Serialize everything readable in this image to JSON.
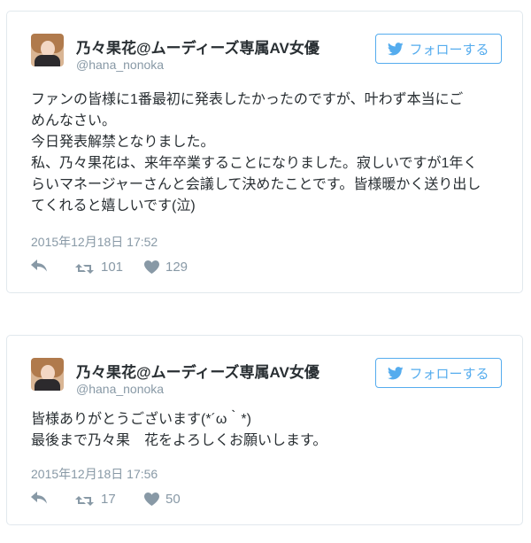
{
  "tweets": [
    {
      "author_name": "乃々果花@ムーディーズ専属AV女優",
      "author_handle": "@hana_nonoka",
      "follow_label": "フォローする",
      "lines": [
        "ファンの皆様に1番最初に発表したかったのですが、叶わず本当にご",
        "めんなさい。",
        "今日発表解禁となりました。",
        "私、乃々果花は、来年卒業することになりました。寂しいですが1年く",
        "らいマネージャーさんと会議して決めたことです。皆様暖かく送り出し",
        "てくれると嬉しいです(泣)"
      ],
      "timestamp": "2015年12月18日 17:52",
      "retweets": "101",
      "likes": "129"
    },
    {
      "author_name": "乃々果花@ムーディーズ専属AV女優",
      "author_handle": "@hana_nonoka",
      "follow_label": "フォローする",
      "lines": [
        "皆様ありがとうございます(*´ω｀*)",
        "最後まで乃々果　花をよろしくお願いします。"
      ],
      "timestamp": "2015年12月18日 17:56",
      "retweets": "17",
      "likes": "50"
    }
  ],
  "colors": {
    "accent": "#55acee",
    "text": "#292f33",
    "muted": "#8899a6",
    "border": "#e1e8ed"
  },
  "icons": {
    "follow": "twitter-bird-icon",
    "reply": "reply-icon",
    "retweet": "retweet-icon",
    "like": "heart-icon"
  }
}
